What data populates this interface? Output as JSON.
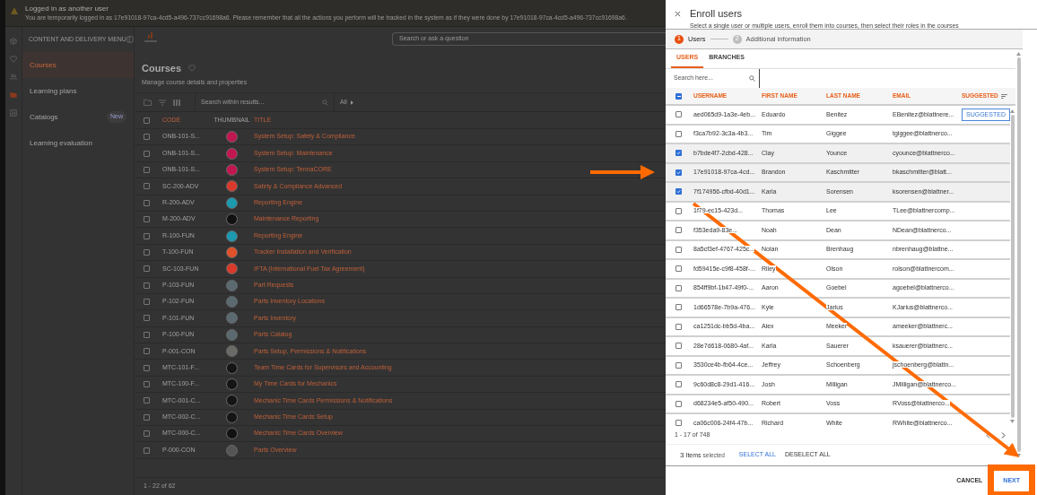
{
  "banner": {
    "title": "Logged in as another user",
    "message": "You are temporarily logged in as 17e91018-97ca-4cd5-a496-737cc91698a6. Please remember that all the actions you perform will be tracked in the system as if they were done by 17e91018-97ca-4cd5-a496-737cc91698a6."
  },
  "icon_rail": [
    {
      "kind": "cube",
      "selected": false
    },
    {
      "kind": "heart",
      "selected": false
    },
    {
      "kind": "users",
      "selected": false
    },
    {
      "kind": "folder",
      "selected": true
    },
    {
      "kind": "chart",
      "selected": false
    }
  ],
  "menu": {
    "title": "CONTENT AND DELIVERY MENU",
    "items": [
      {
        "label": "Courses",
        "selected": true
      },
      {
        "label": "Learning plans",
        "selected": false
      },
      {
        "label": "Catalogs",
        "selected": false,
        "badge": "New"
      },
      {
        "label": "Learning evaluation",
        "selected": false
      }
    ]
  },
  "main": {
    "search_placeholder": "Search or ask a question",
    "title": "Courses",
    "subtitle": "Manage course details and properties",
    "results_search_placeholder": "Search within results...",
    "filter": "All",
    "columns": [
      "CODE",
      "THUMBNAIL",
      "TITLE"
    ],
    "all_checked": false,
    "rows": [
      {
        "code": "ONB-101-S...",
        "title": "System Setup: Safety & Compliance",
        "color": "#c0174f",
        "checked": false
      },
      {
        "code": "ONB-101-S...",
        "title": "System Setup: Maintenance",
        "color": "#c0174f",
        "checked": false
      },
      {
        "code": "ONB-101-S...",
        "title": "System Setup: TennaCORE",
        "color": "#c0174f",
        "checked": false
      },
      {
        "code": "SC-200-ADV",
        "title": "Safety & Compliance Advanced",
        "color": "#d93a2b",
        "checked": false
      },
      {
        "code": "R-200-ADV",
        "title": "Reporting Engine",
        "color": "#1b9ab0",
        "checked": false
      },
      {
        "code": "M-200-ADV",
        "title": "Maintenance Reporting",
        "color": "#111111",
        "checked": false
      },
      {
        "code": "R-100-FUN",
        "title": "Reporting Engine",
        "color": "#1b9ab0",
        "checked": false
      },
      {
        "code": "T-100-FUN",
        "title": "Tracker Installation and Verification",
        "color": "#e0522a",
        "checked": false
      },
      {
        "code": "SC-103-FUN",
        "title": "IFTA (International Fuel Tax Agreement)",
        "color": "#d93a2b",
        "checked": false
      },
      {
        "code": "P-103-FUN",
        "title": "Part Requests",
        "color": "#5a6a70",
        "checked": false
      },
      {
        "code": "P-102-FUN",
        "title": "Parts Inventory Locations",
        "color": "#5a6a70",
        "checked": false
      },
      {
        "code": "P-101-FUN",
        "title": "Parts Inventory",
        "color": "#5a6a70",
        "checked": false
      },
      {
        "code": "P-100-FUN",
        "title": "Parts Catalog",
        "color": "#5a6a70",
        "checked": false
      },
      {
        "code": "P-001-CON",
        "title": "Parts Setup, Permissions & Notifications",
        "color": "#6a6a66",
        "checked": false
      },
      {
        "code": "MTC-101-F...",
        "title": "Team Time Cards for Supervisors and Accounting",
        "color": "#151515",
        "checked": false
      },
      {
        "code": "MTC-100-F...",
        "title": "My Time Cards for Mechanics",
        "color": "#151515",
        "checked": false
      },
      {
        "code": "MTC-001-C...",
        "title": "Mechanic Time Cards Permissions & Notifications",
        "color": "#151515",
        "checked": false
      },
      {
        "code": "MTC-002-C...",
        "title": "Mechanic Time Cards Setup",
        "color": "#151515",
        "checked": false
      },
      {
        "code": "MTC-000-C...",
        "title": "Mechanic Time Cards Overview",
        "color": "#111111",
        "checked": false
      },
      {
        "code": "P-000-CON",
        "title": "Parts Overview",
        "color": "#555555",
        "checked": false
      }
    ],
    "footer": "1 - 22 of 62"
  },
  "dialog": {
    "title": "Enroll users",
    "subtitle": "Select a single user or multiple users, enroll them into courses, then select their roles in the courses",
    "steps": [
      {
        "number": "1",
        "label": "Users",
        "selected": true
      },
      {
        "number": "2",
        "label": "Additional information",
        "selected": false
      }
    ],
    "tabs": [
      {
        "label": "USERS",
        "selected": true
      },
      {
        "label": "BRANCHES",
        "selected": false
      }
    ],
    "search_placeholder": "Search here...",
    "header_indeterminate": true,
    "columns": [
      "USERNAME",
      "FIRST NAME",
      "LAST NAME",
      "EMAIL",
      "SUGGESTED"
    ],
    "rows": [
      {
        "username": "aed065d9-1a3e-4eb...",
        "first_name": "Eduardo",
        "last_name": "Benitez",
        "email": "EBenitez@blattnere...",
        "checked": false,
        "badge": "SUGGESTED"
      },
      {
        "username": "f3ca7b92-3c3a-4b3...",
        "first_name": "Tim",
        "last_name": "Giggee",
        "email": "tgiggee@blattnerco...",
        "checked": false
      },
      {
        "username": "b7bde4f7-2cbd-428...",
        "first_name": "Clay",
        "last_name": "Younce",
        "email": "cyounce@blattnerco...",
        "checked": true
      },
      {
        "username": "17e91018-97ca-4cd...",
        "first_name": "Brandon",
        "last_name": "Kaschmitter",
        "email": "bkaschmitter@blatt...",
        "checked": true
      },
      {
        "username": "7f174956-cfbd-40d1...",
        "first_name": "Karla",
        "last_name": "Sorensen",
        "email": "ksorensen@blattner...",
        "checked": true
      },
      {
        "username": "1f79-ec15-423d...",
        "first_name": "Thomas",
        "last_name": "Lee",
        "email": "TLee@blattnercomp...",
        "checked": false
      },
      {
        "username": "f353eda9-83e...",
        "first_name": "Noah",
        "last_name": "Dean",
        "email": "NDean@blattnerco...",
        "checked": false
      },
      {
        "username": "8a5cf3ef-4767-425c...",
        "first_name": "Nolan",
        "last_name": "Brenhaug",
        "email": "nbrenhaug@blattne...",
        "checked": false
      },
      {
        "username": "fd59415e-c9f8-458f-...",
        "first_name": "Riley",
        "last_name": "Olson",
        "email": "rolson@blattnercom...",
        "checked": false
      },
      {
        "username": "854ff9bf-1b47-49f0-...",
        "first_name": "Aaron",
        "last_name": "Goebel",
        "email": "agoebel@blattnerco...",
        "checked": false
      },
      {
        "username": "1d66578e-7b9a-476...",
        "first_name": "Kyle",
        "last_name": "Jarius",
        "email": "KJarius@blattnerco...",
        "checked": false
      },
      {
        "username": "ca1251dc-bb5d-4ba...",
        "first_name": "Alex",
        "last_name": "Meeker",
        "email": "ameeker@blattnerc...",
        "checked": false
      },
      {
        "username": "28e7d618-0680-4af...",
        "first_name": "Karla",
        "last_name": "Sauerer",
        "email": "ksauerer@blattnerc...",
        "checked": false
      },
      {
        "username": "3530ce4b-fb64-4ce...",
        "first_name": "Jeffrey",
        "last_name": "Schoenberg",
        "email": "jschoenberg@blattn...",
        "checked": false
      },
      {
        "username": "9c60d8c8-29d1-416...",
        "first_name": "Josh",
        "last_name": "Milligan",
        "email": "JMilligan@blattnerco...",
        "checked": false
      },
      {
        "username": "d68234e5-af50-490...",
        "first_name": "Robert",
        "last_name": "Voss",
        "email": "RVoss@blattnerco...",
        "checked": false
      },
      {
        "username": "ca06c006-24f4-47b...",
        "first_name": "Richard",
        "last_name": "White",
        "email": "RWhite@blattnerco...",
        "checked": false
      }
    ],
    "pagination": "1 - 17 of 748",
    "selection_count": "3",
    "selection_unit": "Items",
    "selection_label": "selected",
    "select_all": "SELECT ALL",
    "deselect_all": "DESELECT ALL",
    "cancel": "CANCEL",
    "next": "NEXT"
  }
}
